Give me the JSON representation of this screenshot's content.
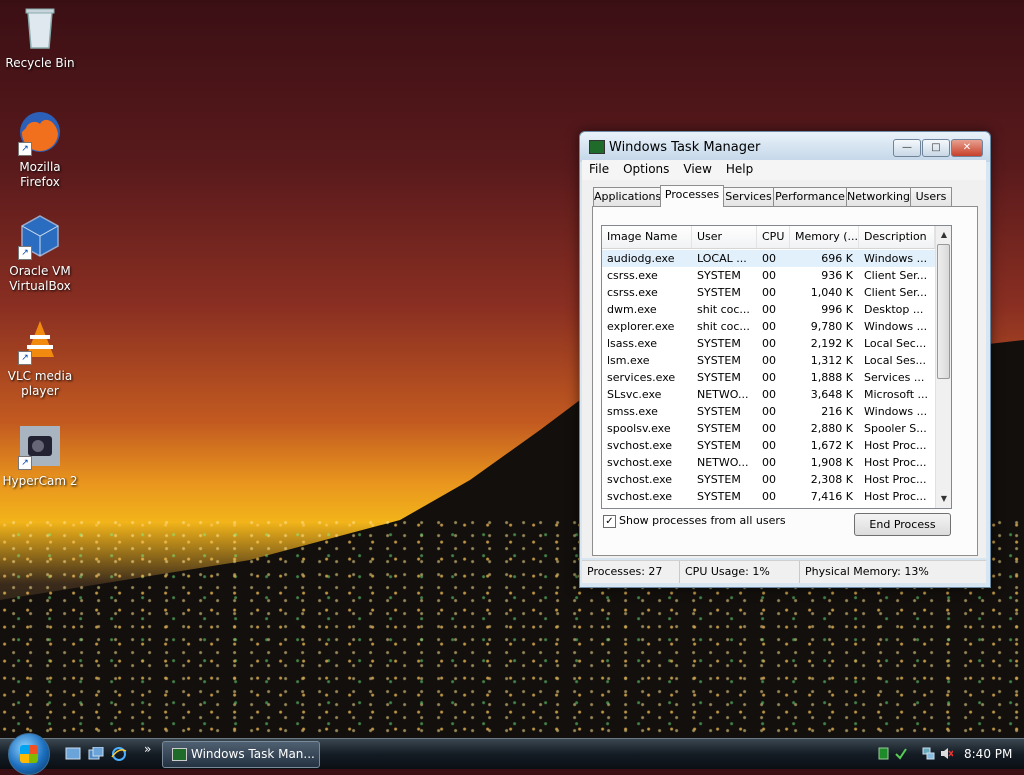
{
  "desktop": {
    "icons": [
      {
        "label": "Recycle Bin",
        "icon": "recycle-bin-icon"
      },
      {
        "label": "Mozilla Firefox",
        "icon": "firefox-icon"
      },
      {
        "label": "Oracle VM VirtualBox",
        "icon": "virtualbox-icon"
      },
      {
        "label": "VLC media player",
        "icon": "vlc-icon"
      },
      {
        "label": "HyperCam 2",
        "icon": "hypercam-icon"
      }
    ]
  },
  "window": {
    "title": "Windows Task Manager",
    "controls": {
      "minimize": "—",
      "maximize": "□",
      "close": "✕"
    },
    "menu": [
      "File",
      "Options",
      "View",
      "Help"
    ],
    "tabs": [
      "Applications",
      "Processes",
      "Services",
      "Performance",
      "Networking",
      "Users"
    ],
    "active_tab": "Processes",
    "columns": [
      "Image Name",
      "User Name",
      "CPU",
      "Memory (...",
      "Description"
    ],
    "processes": [
      {
        "name": "audiodg.exe",
        "user": "LOCAL ...",
        "cpu": "00",
        "memory": "696 K",
        "description": "Windows ..."
      },
      {
        "name": "csrss.exe",
        "user": "SYSTEM",
        "cpu": "00",
        "memory": "936 K",
        "description": "Client Ser..."
      },
      {
        "name": "csrss.exe",
        "user": "SYSTEM",
        "cpu": "00",
        "memory": "1,040 K",
        "description": "Client Ser..."
      },
      {
        "name": "dwm.exe",
        "user": "shit coc...",
        "cpu": "00",
        "memory": "996 K",
        "description": "Desktop ..."
      },
      {
        "name": "explorer.exe",
        "user": "shit coc...",
        "cpu": "00",
        "memory": "9,780 K",
        "description": "Windows ..."
      },
      {
        "name": "lsass.exe",
        "user": "SYSTEM",
        "cpu": "00",
        "memory": "2,192 K",
        "description": "Local Sec..."
      },
      {
        "name": "lsm.exe",
        "user": "SYSTEM",
        "cpu": "00",
        "memory": "1,312 K",
        "description": "Local Ses..."
      },
      {
        "name": "services.exe",
        "user": "SYSTEM",
        "cpu": "00",
        "memory": "1,888 K",
        "description": "Services ..."
      },
      {
        "name": "SLsvc.exe",
        "user": "NETWO...",
        "cpu": "00",
        "memory": "3,648 K",
        "description": "Microsoft ..."
      },
      {
        "name": "smss.exe",
        "user": "SYSTEM",
        "cpu": "00",
        "memory": "216 K",
        "description": "Windows ..."
      },
      {
        "name": "spoolsv.exe",
        "user": "SYSTEM",
        "cpu": "00",
        "memory": "2,880 K",
        "description": "Spooler S..."
      },
      {
        "name": "svchost.exe",
        "user": "SYSTEM",
        "cpu": "00",
        "memory": "1,672 K",
        "description": "Host Proc..."
      },
      {
        "name": "svchost.exe",
        "user": "NETWO...",
        "cpu": "00",
        "memory": "1,908 K",
        "description": "Host Proc..."
      },
      {
        "name": "svchost.exe",
        "user": "SYSTEM",
        "cpu": "00",
        "memory": "2,308 K",
        "description": "Host Proc..."
      },
      {
        "name": "svchost.exe",
        "user": "SYSTEM",
        "cpu": "00",
        "memory": "7,416 K",
        "description": "Host Proc..."
      }
    ],
    "selected_row": 0,
    "show_all_users": {
      "label": "Show processes from all users",
      "checked": true,
      "mark": "✓"
    },
    "end_process_label": "End Process",
    "status": {
      "processes": "Processes: 27",
      "cpu": "CPU Usage: 1%",
      "memory": "Physical Memory: 13%"
    }
  },
  "taskbar": {
    "task_label": "Windows Task Man...",
    "quicklaunch_more": "»",
    "clock": "8:40 PM"
  }
}
